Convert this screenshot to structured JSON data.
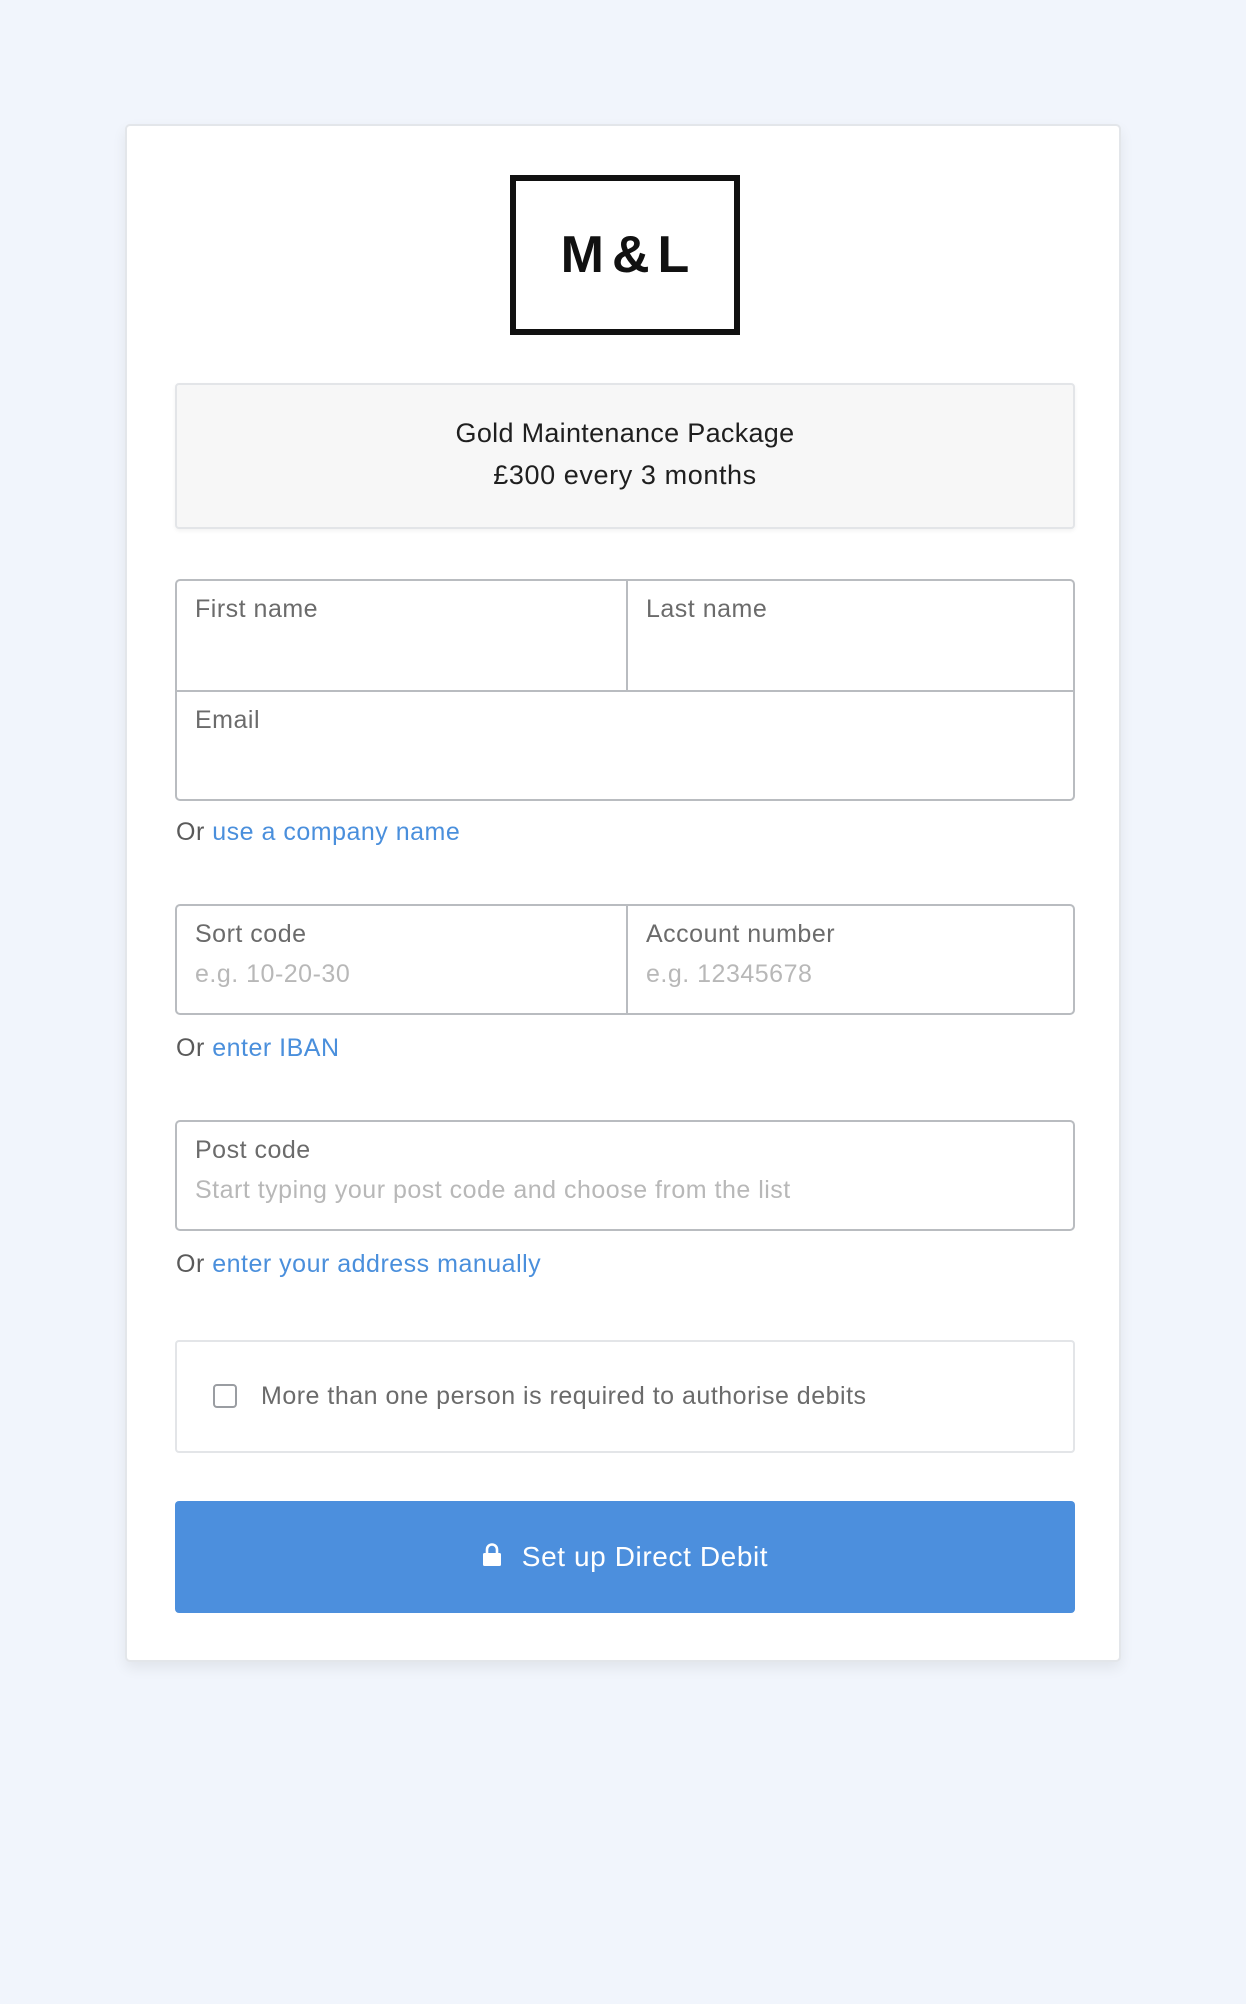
{
  "brand": {
    "logo_text": "M&L"
  },
  "package": {
    "name": "Gold Maintenance Package",
    "price": "£300 every 3 months"
  },
  "form": {
    "first_name": {
      "label": "First name",
      "value": "",
      "placeholder": ""
    },
    "last_name": {
      "label": "Last name",
      "value": "",
      "placeholder": ""
    },
    "email": {
      "label": "Email",
      "value": "",
      "placeholder": ""
    },
    "company_prefix": "Or",
    "company_link": "use a company name",
    "sort_code": {
      "label": "Sort code",
      "value": "",
      "placeholder": "e.g. 10-20-30"
    },
    "account_number": {
      "label": "Account number",
      "value": "",
      "placeholder": "e.g. 12345678"
    },
    "iban_prefix": "Or",
    "iban_link": "enter IBAN",
    "post_code": {
      "label": "Post code",
      "value": "",
      "placeholder": "Start typing your post code and choose from the list"
    },
    "address_prefix": "Or",
    "address_link": "enter your address manually",
    "multi_auth": {
      "label": "More than one person is required to authorise debits",
      "checked": false
    },
    "submit_label": "Set up Direct Debit",
    "submit_icon": "lock-icon"
  },
  "colors": {
    "background": "#f1f5fc",
    "accent": "#4c8fdd",
    "link": "#4a8fdc"
  }
}
